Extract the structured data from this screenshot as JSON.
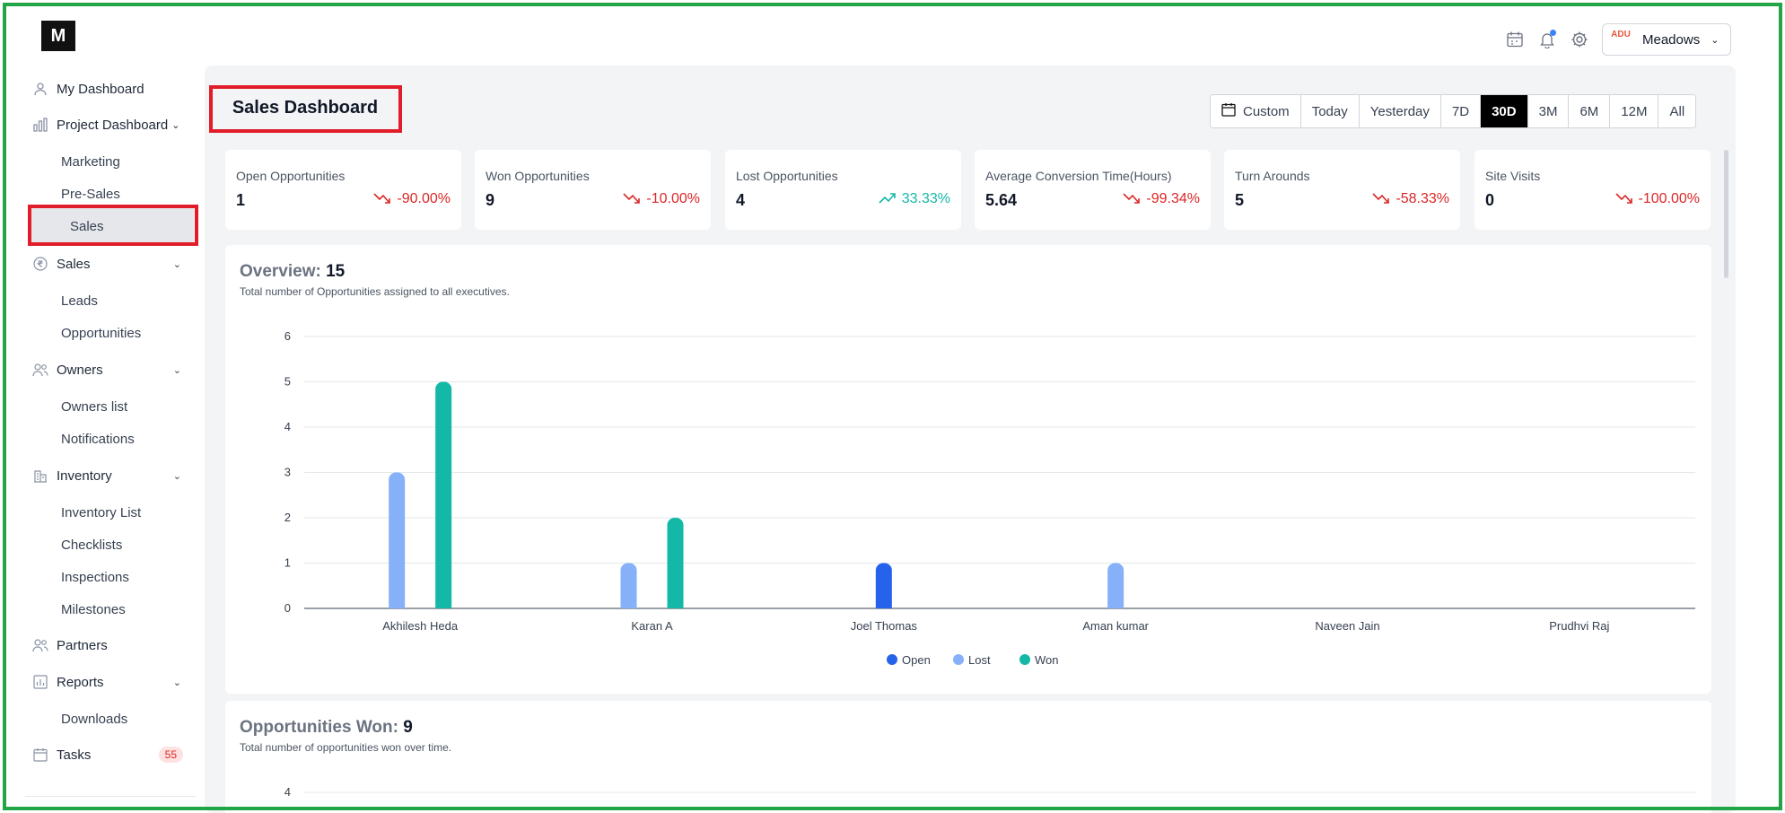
{
  "sidebar": {
    "logo_text": "M",
    "items": [
      {
        "label": "My Dashboard"
      },
      {
        "label": "Project Dashboard"
      },
      {
        "label": "Marketing"
      },
      {
        "label": "Pre-Sales"
      },
      {
        "label": "Sales"
      },
      {
        "label": "Sales"
      },
      {
        "label": "Leads"
      },
      {
        "label": "Opportunities"
      },
      {
        "label": "Owners"
      },
      {
        "label": "Owners list"
      },
      {
        "label": "Notifications"
      },
      {
        "label": "Inventory"
      },
      {
        "label": "Inventory List"
      },
      {
        "label": "Checklists"
      },
      {
        "label": "Inspections"
      },
      {
        "label": "Milestones"
      },
      {
        "label": "Partners"
      },
      {
        "label": "Reports"
      },
      {
        "label": "Downloads"
      },
      {
        "label": "Tasks"
      }
    ],
    "tasks_badge": "55"
  },
  "topbar": {
    "org_name": "Meadows",
    "org_logo_text": "ADU"
  },
  "page": {
    "title": "Sales Dashboard"
  },
  "ranges": [
    {
      "label": "Custom"
    },
    {
      "label": "Today"
    },
    {
      "label": "Yesterday"
    },
    {
      "label": "7D"
    },
    {
      "label": "30D"
    },
    {
      "label": "3M"
    },
    {
      "label": "6M"
    },
    {
      "label": "12M"
    },
    {
      "label": "All"
    }
  ],
  "active_range": "30D",
  "kpis": [
    {
      "label": "Open Opportunities",
      "value": "1",
      "delta": "-90.00%",
      "trend": "down"
    },
    {
      "label": "Won Opportunities",
      "value": "9",
      "delta": "-10.00%",
      "trend": "down"
    },
    {
      "label": "Lost Opportunities",
      "value": "4",
      "delta": "33.33%",
      "trend": "up"
    },
    {
      "label": "Average Conversion Time(Hours)",
      "value": "5.64",
      "delta": "-99.34%",
      "trend": "down"
    },
    {
      "label": "Turn Arounds",
      "value": "5",
      "delta": "-58.33%",
      "trend": "down"
    },
    {
      "label": "Site Visits",
      "value": "0",
      "delta": "-100.00%",
      "trend": "down"
    }
  ],
  "overview": {
    "title": "Overview:",
    "count": "15",
    "subtitle": "Total number of Opportunities assigned to all executives."
  },
  "won": {
    "title": "Opportunities Won:",
    "count": "9",
    "subtitle": "Total number of opportunities won over time."
  },
  "colors": {
    "open": "#2563eb",
    "lost": "#86b1f9",
    "won": "#14b8a6",
    "accent": "#000000",
    "down": "#dc2626",
    "up": "#14b8a6"
  },
  "chart_data": [
    {
      "type": "bar",
      "categories": [
        "Akhilesh Heda",
        "Karan A",
        "Joel Thomas",
        "Aman kumar",
        "Naveen Jain",
        "Prudhvi Raj"
      ],
      "series": [
        {
          "name": "Open",
          "values": [
            0,
            0,
            1,
            0,
            0,
            0
          ]
        },
        {
          "name": "Lost",
          "values": [
            3,
            1,
            0,
            1,
            0,
            0
          ]
        },
        {
          "name": "Won",
          "values": [
            5,
            2,
            0,
            0,
            0,
            0
          ]
        }
      ],
      "ylim": [
        0,
        6
      ],
      "yticks": [
        0,
        1,
        2,
        3,
        4,
        5,
        6
      ],
      "grid": true,
      "legend": "bottom-center"
    },
    {
      "type": "line",
      "yticks": [
        4
      ],
      "grid": true
    }
  ]
}
